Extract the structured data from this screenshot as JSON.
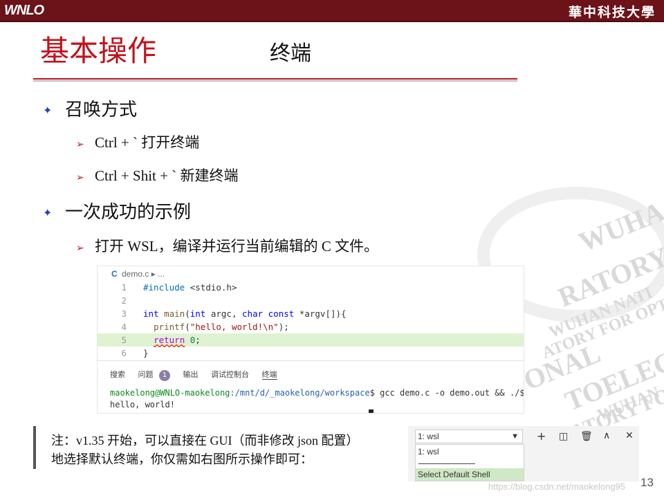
{
  "header": {
    "left_logo": "WNLO",
    "right_logo": "華中科技大學"
  },
  "title": {
    "main": "基本操作",
    "sub": "终端"
  },
  "bullets": [
    {
      "text": "召唤方式",
      "sub": [
        "Ctrl + ` 打开终端",
        "Ctrl + Shit + ` 新建终端"
      ]
    },
    {
      "text": "一次成功的示例",
      "sub": [
        "打开 WSL，编译并运行当前编辑的 C 文件。"
      ]
    }
  ],
  "editor": {
    "tab_icon": "C",
    "file_name": "demo.c",
    "breadcrumb_more": "▸ ...",
    "lines": [
      {
        "num": "1"
      },
      {
        "num": "2"
      },
      {
        "num": "3"
      },
      {
        "num": "4"
      },
      {
        "num": "5"
      },
      {
        "num": "6"
      }
    ],
    "panel_tabs": [
      "搜索",
      "问题",
      "输出",
      "调试控制台",
      "终端"
    ],
    "problems_count": "1",
    "terminal": {
      "user": "maokelong@WNLO-maokelong",
      "path": ":/mnt/d/_maokelong/workspace",
      "command": "$ gcc demo.c -o demo.out && ./$_",
      "output": "hello, world!"
    }
  },
  "note": {
    "line1": "注：v1.35 开始，可以直接在 GUI（而非修改 json 配置）",
    "line2": "地选择默认终端，你仅需如右图所示操作即可："
  },
  "shell_selector": {
    "selected": "1: wsl",
    "options": [
      "1: wsl",
      "Select Default Shell"
    ]
  },
  "page_number": "13",
  "csdn_watermark": "https://blog.csdn.net/maokelong95",
  "watermark_lines": [
    "WUHA",
    "RATORY F",
    "WUHAN NATI",
    "ATORY FOR OPT",
    "ONAL",
    "TOELECT",
    "WUHAN",
    "RATORY FO"
  ]
}
